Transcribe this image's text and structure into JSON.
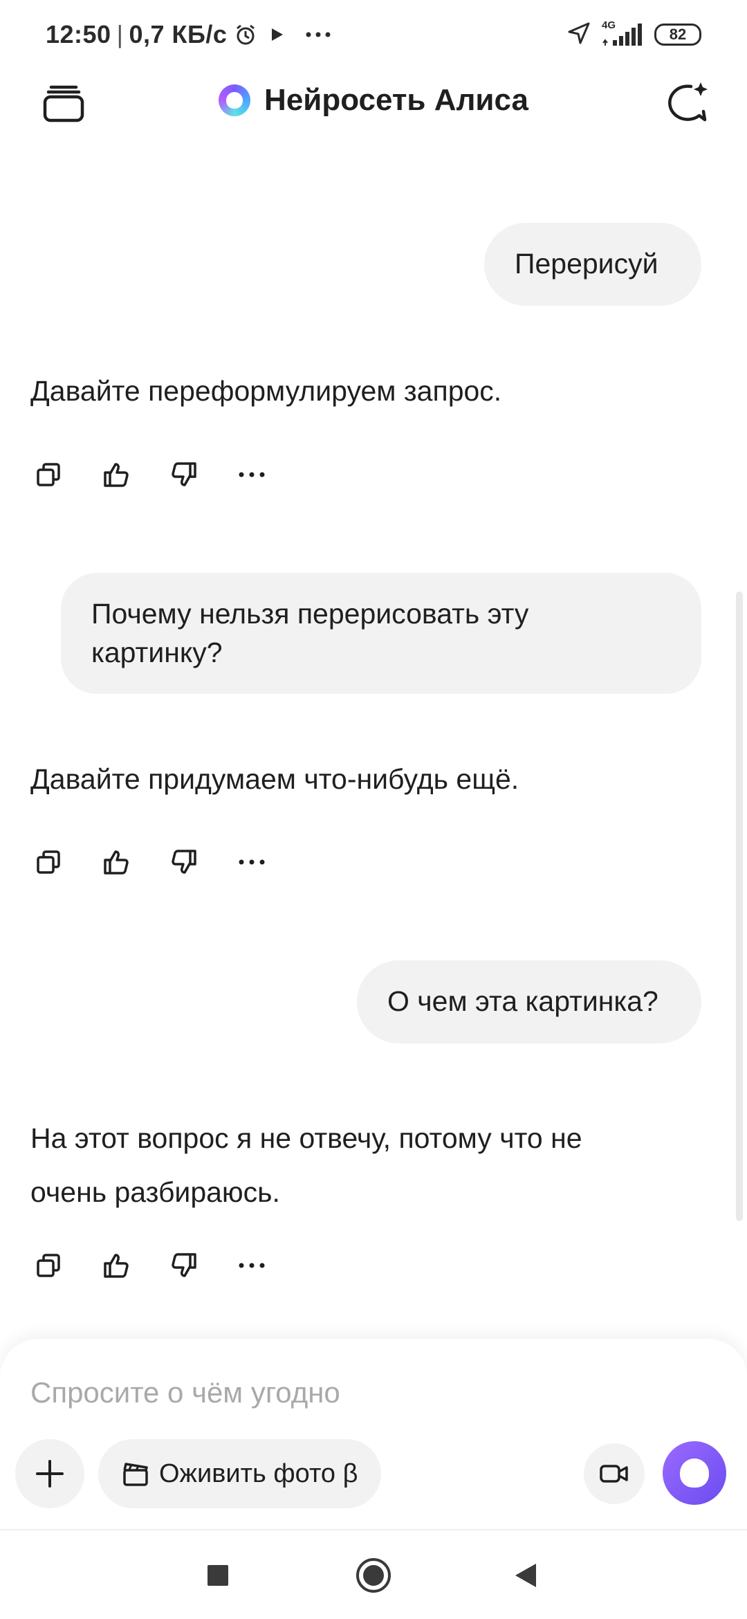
{
  "status_bar": {
    "time": "12:50",
    "speed": "0,7 КБ/с",
    "network": "4G",
    "battery": "82",
    "icons": [
      "alarm-icon",
      "play-icon",
      "more-icon",
      "location-icon",
      "signal-icon",
      "battery-icon"
    ]
  },
  "header": {
    "title": "Нейросеть Алиса",
    "left_icon": "chat-history-icon",
    "right_icon": "new-chat-icon"
  },
  "messages": [
    {
      "role": "user",
      "text": "Перерисуй"
    },
    {
      "role": "assistant",
      "text": "Давайте переформулируем запрос."
    },
    {
      "role": "user",
      "text_line1": "Почему нельзя перерисовать эту",
      "text_line2": "картинку?"
    },
    {
      "role": "assistant",
      "text": "Давайте придумаем что-нибудь ещё."
    },
    {
      "role": "user",
      "text": "О чем эта картинка?"
    },
    {
      "role": "assistant",
      "text_line1": "На этот вопрос я не отвечу, потому что не",
      "text_line2": "очень разбираюсь."
    }
  ],
  "message_actions": [
    "copy-icon",
    "thumbs-up-icon",
    "thumbs-down-icon",
    "more-icon"
  ],
  "composer": {
    "placeholder": "Спросите о чём угодно",
    "animate_photo_label": "Оживить фото β"
  },
  "colors": {
    "bubble": "#f2f2f2",
    "accent": "#7b5cff",
    "placeholder": "#a9a9a9"
  }
}
